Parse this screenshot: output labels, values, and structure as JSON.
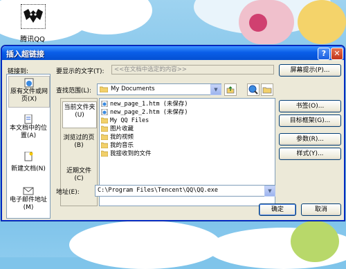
{
  "desktop": {
    "icon_label": "腾讯QQ"
  },
  "dialog": {
    "title": "插入超链接",
    "help_symbol": "?",
    "close_symbol": "✕"
  },
  "link_to": {
    "label": "链接到:",
    "items": [
      {
        "label": "原有文件或网页(X)",
        "icon": "globe-page-icon",
        "active": true
      },
      {
        "label": "本文档中的位置(A)",
        "icon": "document-position-icon",
        "active": false
      },
      {
        "label": "新建文档(N)",
        "icon": "new-document-icon",
        "active": false
      },
      {
        "label": "电子邮件地址(M)",
        "icon": "email-icon",
        "active": false
      }
    ]
  },
  "display_text": {
    "label": "要显示的文字(T):",
    "value": "<<在文档中选定的内容>>"
  },
  "screen_tip_button": "屏幕提示(P)...",
  "look_in": {
    "label": "查找范围(L):",
    "value": "My Documents"
  },
  "places": [
    {
      "label": "当前文件夹(U)",
      "active": true
    },
    {
      "label": "浏览过的页(B)",
      "active": false
    },
    {
      "label": "近期文件(C)",
      "active": false
    }
  ],
  "files": [
    {
      "name": "new_page_1.htm (未保存)",
      "icon": "web-page-icon"
    },
    {
      "name": "new_page_2.htm (未保存)",
      "icon": "web-page-icon"
    },
    {
      "name": "My QQ Files",
      "icon": "folder-icon"
    },
    {
      "name": "图片收藏",
      "icon": "folder-icon"
    },
    {
      "name": "我的视频",
      "icon": "folder-icon"
    },
    {
      "name": "我的音乐",
      "icon": "folder-icon"
    },
    {
      "name": "我接收到的文件",
      "icon": "folder-icon"
    }
  ],
  "side_buttons": [
    "书签(O)...",
    "目标框架(G)...",
    "参数(R)...",
    "样式(Y)..."
  ],
  "address": {
    "label": "地址(E):",
    "value": "C:\\Program Files\\Tencent\\QQ\\QQ.exe"
  },
  "ok_button": "确定",
  "cancel_button": "取消",
  "colors": {
    "title_bar": "#0a5ee8",
    "dialog_bg": "#ece9d8",
    "field_border": "#7f9db9"
  }
}
